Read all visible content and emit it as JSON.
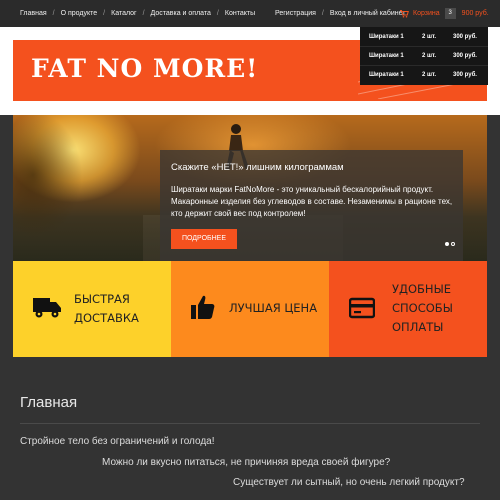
{
  "topbar": {
    "nav": [
      "Главная",
      "О продукте",
      "Каталог",
      "Доставка и оплата",
      "Контакты"
    ],
    "auth": {
      "register": "Регистрация",
      "login": "Вход в личный кабинет"
    },
    "cart": {
      "label": "Корзина",
      "count": "3",
      "total": "900 руб.",
      "icon": "shopping-cart-icon"
    }
  },
  "cart_dropdown": {
    "items": [
      {
        "name": "Ширатаки 1",
        "qty": "2 шт.",
        "price": "300 руб."
      },
      {
        "name": "Ширатаки 1",
        "qty": "2 шт.",
        "price": "300 руб."
      },
      {
        "name": "Ширатаки 1",
        "qty": "2 шт.",
        "price": "300 руб."
      }
    ]
  },
  "header": {
    "logo": "FAT NO MORE!"
  },
  "hero": {
    "title": "Скажите «НЕТ!» лишним килограммам",
    "description": "Ширатаки марки FatNoMore - это уникальный бескалорийный продукт. Макаронные изделия без углеводов в составе. Незаменимы в рационе тех, кто держит свой вес под контролем!",
    "button": "ПОДРОБНЕЕ"
  },
  "features": [
    {
      "icon": "truck-icon",
      "lines": [
        "БЫСТРАЯ",
        "ДОСТАВКА"
      ]
    },
    {
      "icon": "thumbs-up-icon",
      "lines": [
        "ЛУЧШАЯ ЦЕНА"
      ]
    },
    {
      "icon": "credit-card-icon",
      "lines": [
        "УДОБНЫЕ",
        "СПОСОБЫ",
        "ОПЛАТЫ"
      ]
    }
  ],
  "main": {
    "title": "Главная",
    "lines": [
      "Стройное тело без ограничений и голода!",
      "Можно ли вкусно питаться, не причиняя вреда своей фигуре?",
      "Существует ли сытный, но очень легкий продукт?"
    ]
  },
  "colors": {
    "accent": "#f4511e",
    "feature_yellow": "#fdd12a",
    "feature_orange": "#fd8a1d",
    "feature_red": "#f4511e",
    "background": "#333333"
  }
}
